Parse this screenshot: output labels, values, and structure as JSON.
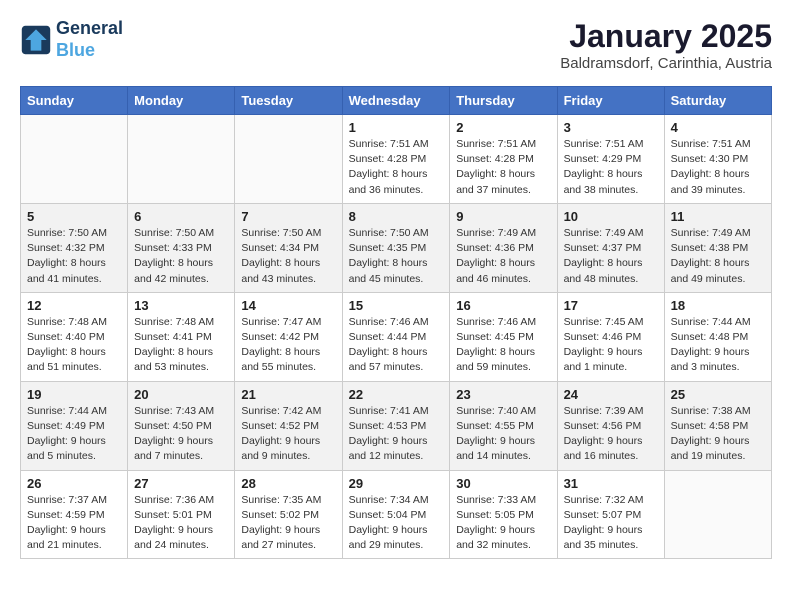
{
  "header": {
    "logo_line1": "General",
    "logo_line2": "Blue",
    "month_title": "January 2025",
    "location": "Baldramsdorf, Carinthia, Austria"
  },
  "days_of_week": [
    "Sunday",
    "Monday",
    "Tuesday",
    "Wednesday",
    "Thursday",
    "Friday",
    "Saturday"
  ],
  "weeks": [
    [
      {
        "day": "",
        "info": ""
      },
      {
        "day": "",
        "info": ""
      },
      {
        "day": "",
        "info": ""
      },
      {
        "day": "1",
        "info": "Sunrise: 7:51 AM\nSunset: 4:28 PM\nDaylight: 8 hours and 36 minutes."
      },
      {
        "day": "2",
        "info": "Sunrise: 7:51 AM\nSunset: 4:28 PM\nDaylight: 8 hours and 37 minutes."
      },
      {
        "day": "3",
        "info": "Sunrise: 7:51 AM\nSunset: 4:29 PM\nDaylight: 8 hours and 38 minutes."
      },
      {
        "day": "4",
        "info": "Sunrise: 7:51 AM\nSunset: 4:30 PM\nDaylight: 8 hours and 39 minutes."
      }
    ],
    [
      {
        "day": "5",
        "info": "Sunrise: 7:50 AM\nSunset: 4:32 PM\nDaylight: 8 hours and 41 minutes."
      },
      {
        "day": "6",
        "info": "Sunrise: 7:50 AM\nSunset: 4:33 PM\nDaylight: 8 hours and 42 minutes."
      },
      {
        "day": "7",
        "info": "Sunrise: 7:50 AM\nSunset: 4:34 PM\nDaylight: 8 hours and 43 minutes."
      },
      {
        "day": "8",
        "info": "Sunrise: 7:50 AM\nSunset: 4:35 PM\nDaylight: 8 hours and 45 minutes."
      },
      {
        "day": "9",
        "info": "Sunrise: 7:49 AM\nSunset: 4:36 PM\nDaylight: 8 hours and 46 minutes."
      },
      {
        "day": "10",
        "info": "Sunrise: 7:49 AM\nSunset: 4:37 PM\nDaylight: 8 hours and 48 minutes."
      },
      {
        "day": "11",
        "info": "Sunrise: 7:49 AM\nSunset: 4:38 PM\nDaylight: 8 hours and 49 minutes."
      }
    ],
    [
      {
        "day": "12",
        "info": "Sunrise: 7:48 AM\nSunset: 4:40 PM\nDaylight: 8 hours and 51 minutes."
      },
      {
        "day": "13",
        "info": "Sunrise: 7:48 AM\nSunset: 4:41 PM\nDaylight: 8 hours and 53 minutes."
      },
      {
        "day": "14",
        "info": "Sunrise: 7:47 AM\nSunset: 4:42 PM\nDaylight: 8 hours and 55 minutes."
      },
      {
        "day": "15",
        "info": "Sunrise: 7:46 AM\nSunset: 4:44 PM\nDaylight: 8 hours and 57 minutes."
      },
      {
        "day": "16",
        "info": "Sunrise: 7:46 AM\nSunset: 4:45 PM\nDaylight: 8 hours and 59 minutes."
      },
      {
        "day": "17",
        "info": "Sunrise: 7:45 AM\nSunset: 4:46 PM\nDaylight: 9 hours and 1 minute."
      },
      {
        "day": "18",
        "info": "Sunrise: 7:44 AM\nSunset: 4:48 PM\nDaylight: 9 hours and 3 minutes."
      }
    ],
    [
      {
        "day": "19",
        "info": "Sunrise: 7:44 AM\nSunset: 4:49 PM\nDaylight: 9 hours and 5 minutes."
      },
      {
        "day": "20",
        "info": "Sunrise: 7:43 AM\nSunset: 4:50 PM\nDaylight: 9 hours and 7 minutes."
      },
      {
        "day": "21",
        "info": "Sunrise: 7:42 AM\nSunset: 4:52 PM\nDaylight: 9 hours and 9 minutes."
      },
      {
        "day": "22",
        "info": "Sunrise: 7:41 AM\nSunset: 4:53 PM\nDaylight: 9 hours and 12 minutes."
      },
      {
        "day": "23",
        "info": "Sunrise: 7:40 AM\nSunset: 4:55 PM\nDaylight: 9 hours and 14 minutes."
      },
      {
        "day": "24",
        "info": "Sunrise: 7:39 AM\nSunset: 4:56 PM\nDaylight: 9 hours and 16 minutes."
      },
      {
        "day": "25",
        "info": "Sunrise: 7:38 AM\nSunset: 4:58 PM\nDaylight: 9 hours and 19 minutes."
      }
    ],
    [
      {
        "day": "26",
        "info": "Sunrise: 7:37 AM\nSunset: 4:59 PM\nDaylight: 9 hours and 21 minutes."
      },
      {
        "day": "27",
        "info": "Sunrise: 7:36 AM\nSunset: 5:01 PM\nDaylight: 9 hours and 24 minutes."
      },
      {
        "day": "28",
        "info": "Sunrise: 7:35 AM\nSunset: 5:02 PM\nDaylight: 9 hours and 27 minutes."
      },
      {
        "day": "29",
        "info": "Sunrise: 7:34 AM\nSunset: 5:04 PM\nDaylight: 9 hours and 29 minutes."
      },
      {
        "day": "30",
        "info": "Sunrise: 7:33 AM\nSunset: 5:05 PM\nDaylight: 9 hours and 32 minutes."
      },
      {
        "day": "31",
        "info": "Sunrise: 7:32 AM\nSunset: 5:07 PM\nDaylight: 9 hours and 35 minutes."
      },
      {
        "day": "",
        "info": ""
      }
    ]
  ]
}
